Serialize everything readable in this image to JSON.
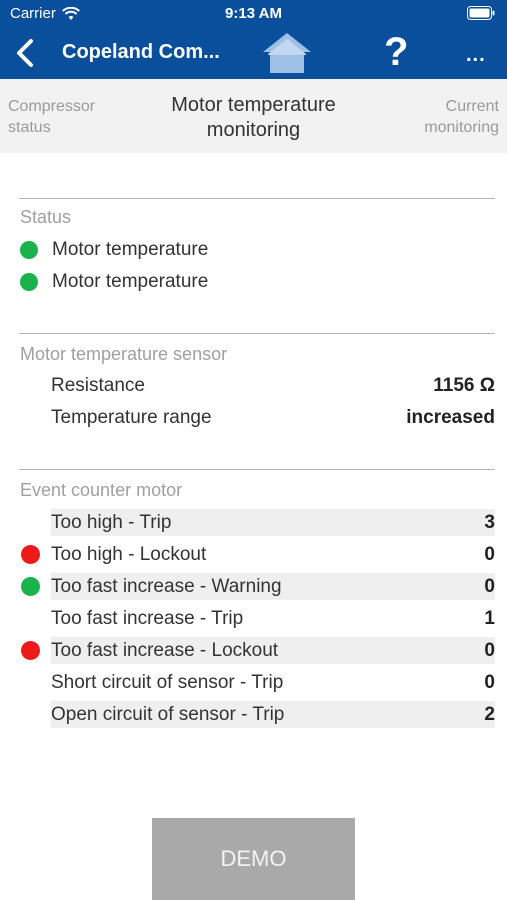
{
  "status_bar": {
    "carrier": "Carrier",
    "time": "9:13 AM"
  },
  "nav": {
    "title": "Copeland Com...",
    "help": "?",
    "more": "..."
  },
  "tabs": {
    "left": [
      "Compressor",
      "status"
    ],
    "center": [
      "Motor temperature",
      "monitoring"
    ],
    "right": [
      "Current",
      "monitoring"
    ]
  },
  "status_section": {
    "title": "Status",
    "items": [
      {
        "label": "Motor temperature",
        "indicator": "green"
      },
      {
        "label": "Motor temperature",
        "indicator": "green"
      }
    ]
  },
  "sensor_section": {
    "title": "Motor temperature sensor",
    "rows": [
      {
        "label": "Resistance",
        "value": "1156 Ω"
      },
      {
        "label": "Temperature range",
        "value": "increased"
      }
    ]
  },
  "event_section": {
    "title": "Event counter motor",
    "rows": [
      {
        "label": "Too high - Trip",
        "value": "3",
        "indicator": "none"
      },
      {
        "label": "Too high - Lockout",
        "value": "0",
        "indicator": "red"
      },
      {
        "label": "Too fast increase - Warning",
        "value": "0",
        "indicator": "green"
      },
      {
        "label": "Too fast increase - Trip",
        "value": "1",
        "indicator": "none"
      },
      {
        "label": "Too fast increase - Lockout",
        "value": "0",
        "indicator": "red"
      },
      {
        "label": "Short circuit of sensor - Trip",
        "value": "0",
        "indicator": "none"
      },
      {
        "label": "Open circuit of sensor - Trip",
        "value": "2",
        "indicator": "none"
      }
    ]
  },
  "demo_button": "DEMO",
  "colors": {
    "nav_blue": "#0a4f9c",
    "ok_green": "#19b24b",
    "alarm_red": "#ee1a1a",
    "demo_gray": "#a9a9a9"
  }
}
